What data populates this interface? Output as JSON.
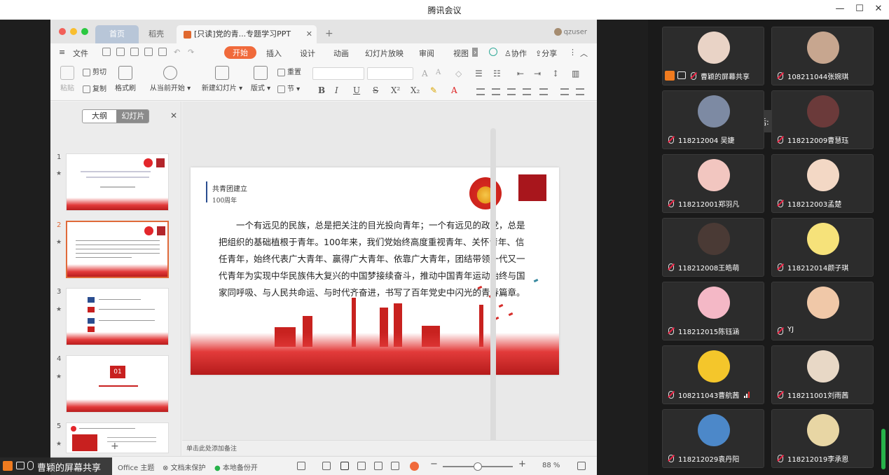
{
  "window": {
    "title": "腾讯会议",
    "min": "—",
    "max": "☐",
    "close": "✕"
  },
  "wps": {
    "tabs": {
      "home": "首页",
      "docer": "稻壳",
      "active": "[只读]党的青...专题学习PPT",
      "close": "✕",
      "new": "+"
    },
    "user": "qzuser",
    "menu": {
      "file": "文件",
      "items": [
        "开始",
        "插入",
        "设计",
        "动画",
        "幻灯片放映",
        "审阅",
        "视图"
      ],
      "collab": "协作",
      "share": "分享"
    },
    "ribbon": {
      "paste": "粘贴",
      "cut": "剪切",
      "copy": "复制",
      "format_painter": "格式刷",
      "play_from_current": "从当前开始",
      "new_slide": "新建幻灯片",
      "layout": "版式",
      "reset": "重置",
      "section": "节"
    },
    "pane": {
      "outline": "大纲",
      "slides": "幻灯片",
      "close": "✕",
      "numbers": [
        "1",
        "2",
        "3",
        "4",
        "5"
      ],
      "thumb4_number": "01",
      "add": "+"
    },
    "slide": {
      "title_line1": "共青团建立",
      "title_line2": "100周年",
      "paragraph": "一个有远见的民族，总是把关注的目光投向青年；一个有远见的政党，总是把组织的基础植根于青年。100年来，我们党始终高度重视青年、关怀青年、信任青年，始终代表广大青年、赢得广大青年、依靠广大青年，团结带领一代又一代青年为实现中华民族伟大复兴的中国梦接续奋斗，推动中国青年运动始终与国家同呼吸、与人民共命运、与时代齐奋进，书写了百年党史中闪光的青春篇章。"
    },
    "notes_placeholder": "单击此处添加备注",
    "status": {
      "theme": "Office 主题",
      "protect": "文档未保护",
      "backup": "本地备份开",
      "zoom": "88 %",
      "minus": "−",
      "plus": "+"
    }
  },
  "sharer_label": "曹颖的屏幕共享",
  "speaking": "正在讲话: 大大旭;",
  "participants": [
    {
      "name": "曹颖的屏幕共享",
      "avatar_color": "#e9d3c6",
      "host": true
    },
    {
      "name": "108211044张婉琪",
      "avatar_color": "#c7a68f",
      "host": false
    },
    {
      "name": "118212004 吴婕",
      "avatar_color": "#7d8aa3",
      "host": false
    },
    {
      "name": "118212009曹慧珏",
      "avatar_color": "#6b3a3a",
      "host": false
    },
    {
      "name": "118212001郑羽凡",
      "avatar_color": "#f2c6c0",
      "host": false
    },
    {
      "name": "118212003孟楚",
      "avatar_color": "#f3d8c5",
      "host": false
    },
    {
      "name": "118212008王皓萌",
      "avatar_color": "#4a3a35",
      "host": false
    },
    {
      "name": "118212014颜子琪",
      "avatar_color": "#f6e27a",
      "host": false
    },
    {
      "name": "118212015陈钰涵",
      "avatar_color": "#f4b8c6",
      "host": false
    },
    {
      "name": "YJ",
      "avatar_color": "#f0c8a8",
      "host": false
    },
    {
      "name": "108211043曹航茜",
      "avatar_color": "#f4c62b",
      "host": false
    },
    {
      "name": "118211001刘雨茜",
      "avatar_color": "#e8d8c6",
      "host": false
    },
    {
      "name": "118212029袁丹阳",
      "avatar_color": "#4c88c9",
      "host": false
    },
    {
      "name": "118212019李承恩",
      "avatar_color": "#e8d6a4",
      "host": false
    }
  ]
}
